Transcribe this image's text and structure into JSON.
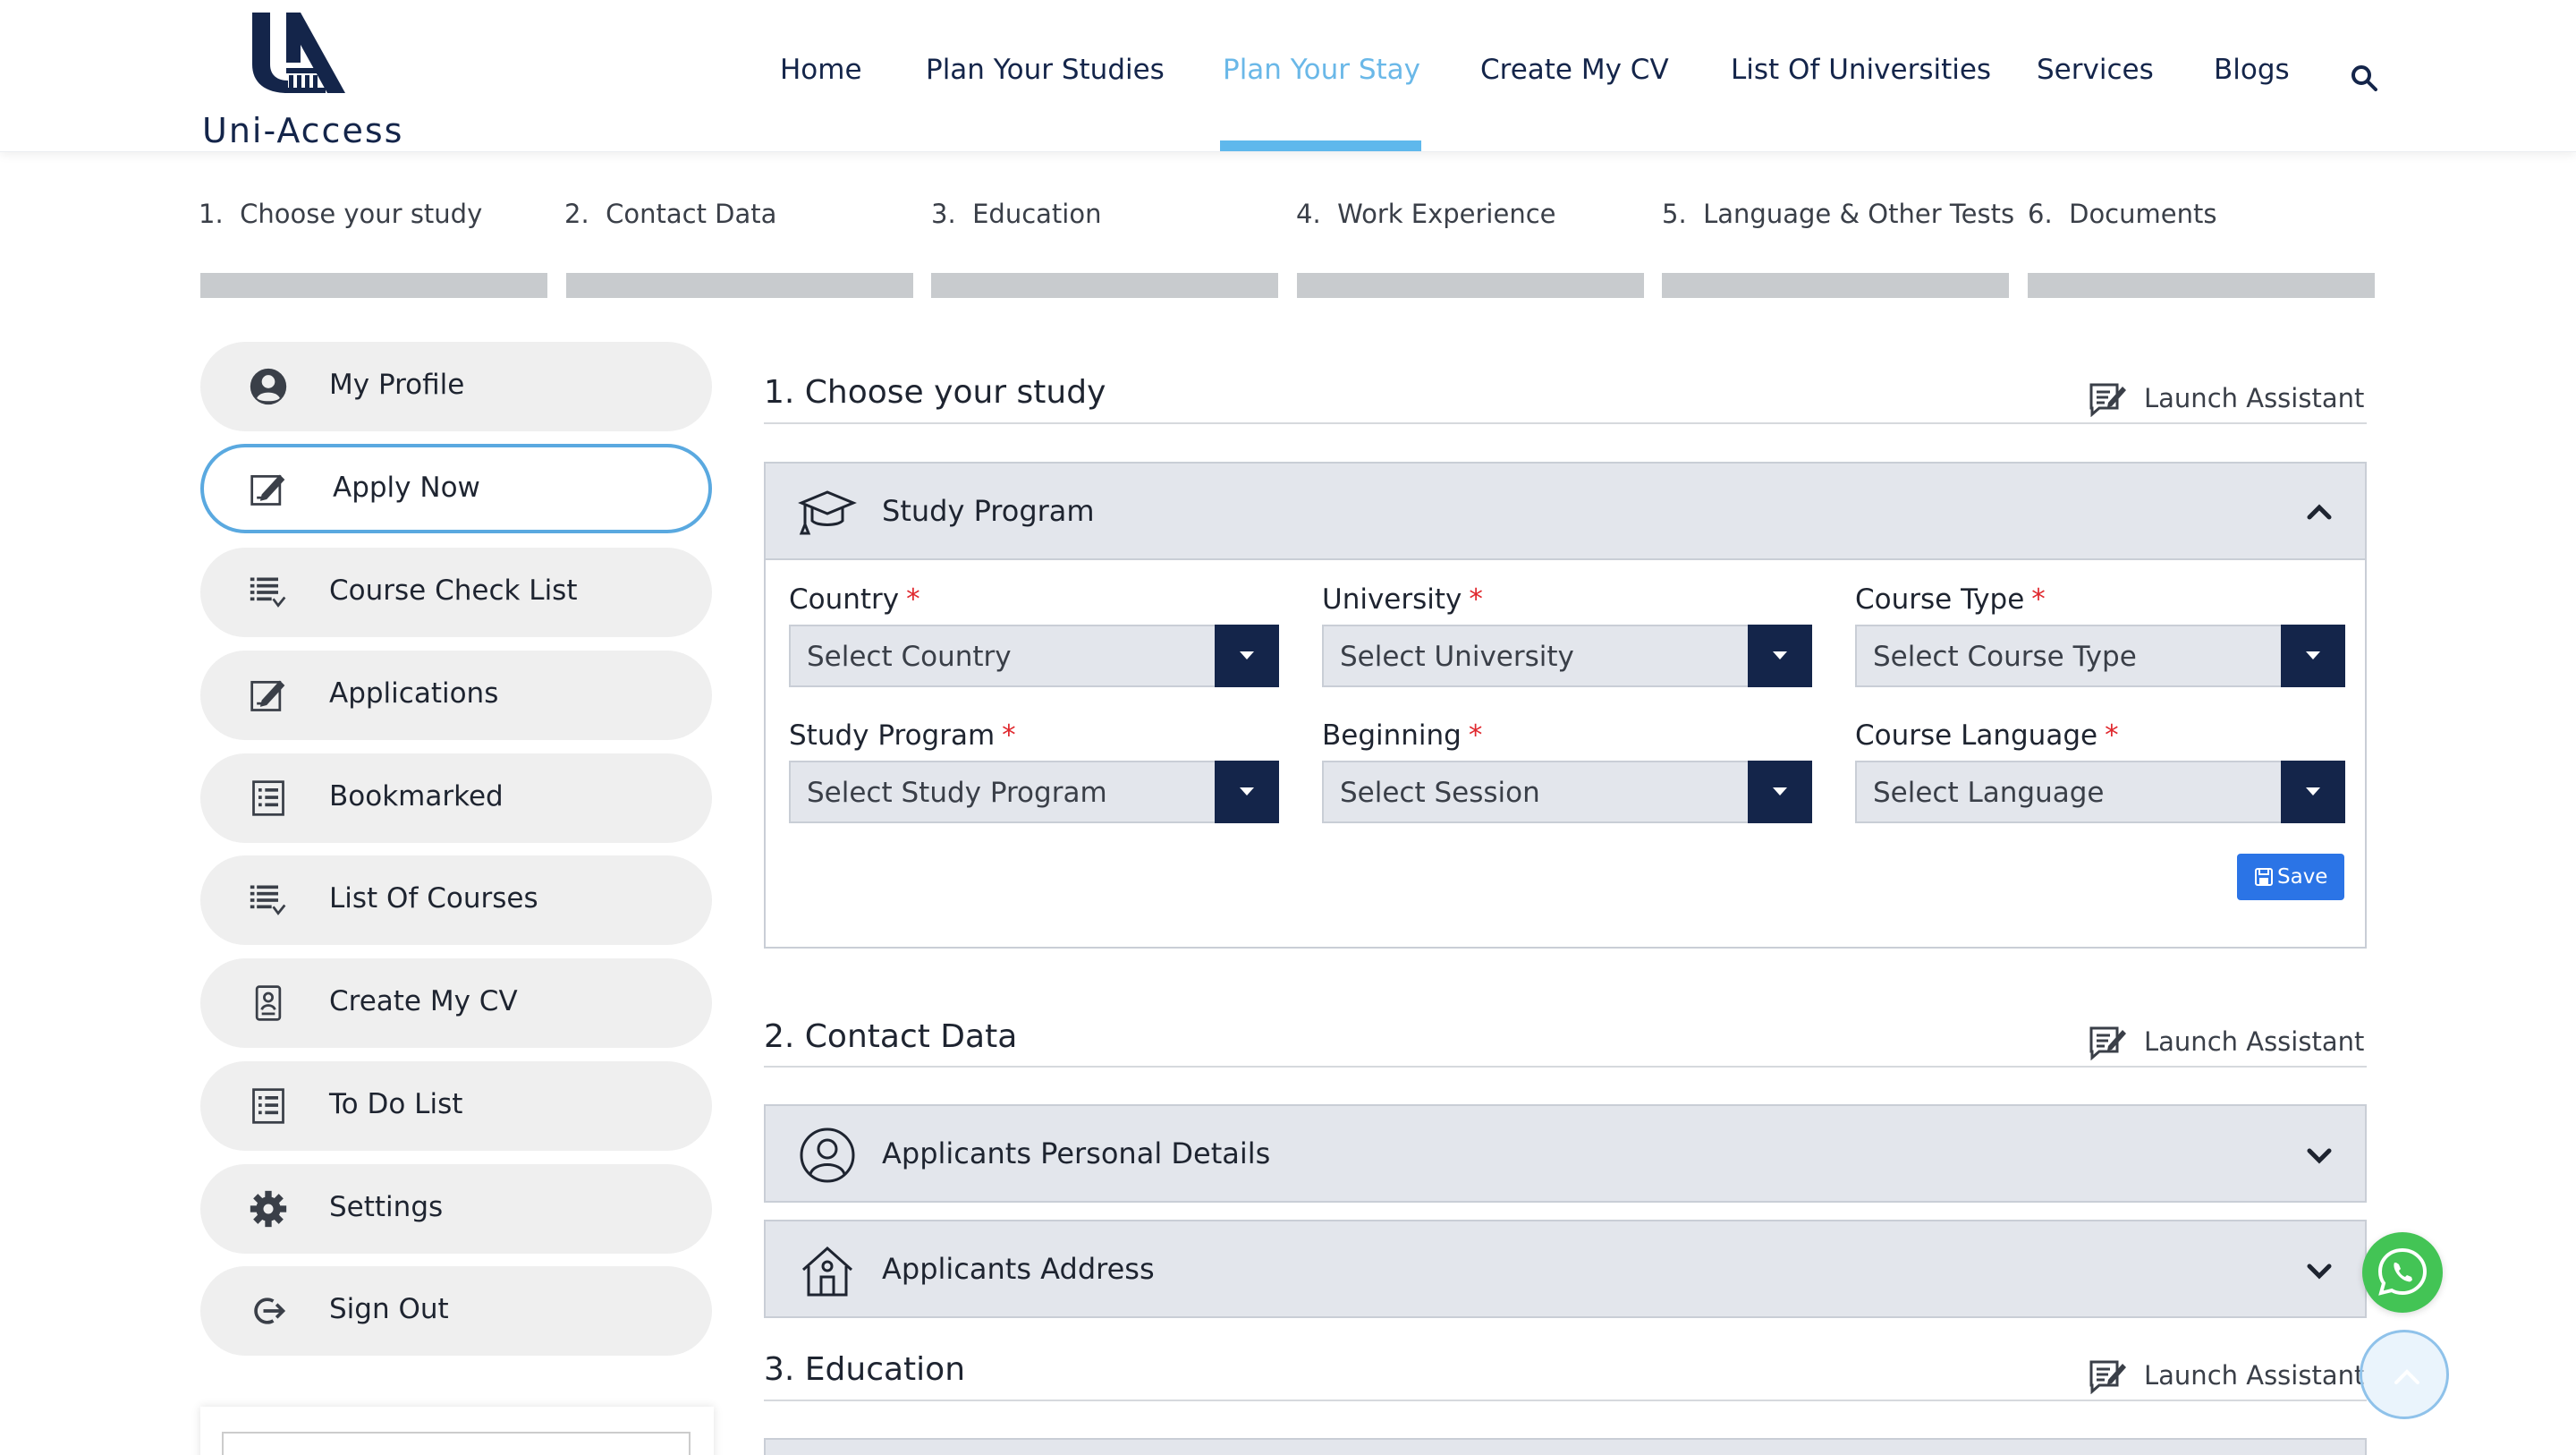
{
  "brand": {
    "name": "Uni-Access",
    "color": "#14254a"
  },
  "nav": {
    "items": [
      "Home",
      "Plan Your Studies",
      "Plan Your Stay",
      "Create My CV",
      "List Of Universities",
      "Services",
      "Blogs"
    ],
    "active": "Plan Your Stay",
    "active_color": "#6ab8e8",
    "search_icon": "search-icon"
  },
  "steps": [
    {
      "num": "1.",
      "label": "Choose your study"
    },
    {
      "num": "2.",
      "label": "Contact Data"
    },
    {
      "num": "3.",
      "label": "Education"
    },
    {
      "num": "4.",
      "label": "Work Experience"
    },
    {
      "num": "5.",
      "label": "Language & Other Tests"
    },
    {
      "num": "6.",
      "label": "Documents"
    }
  ],
  "sidebar": {
    "items": [
      {
        "label": "My Profile",
        "icon": "user-circle-icon"
      },
      {
        "label": "Apply Now",
        "icon": "edit-icon",
        "active": true
      },
      {
        "label": "Course Check List",
        "icon": "checklist-icon"
      },
      {
        "label": "Applications",
        "icon": "edit-icon"
      },
      {
        "label": "Bookmarked",
        "icon": "list-doc-icon"
      },
      {
        "label": "List Of Courses",
        "icon": "checklist-icon"
      },
      {
        "label": "Create My CV",
        "icon": "cv-icon"
      },
      {
        "label": "To Do List",
        "icon": "list-doc-icon"
      },
      {
        "label": "Settings",
        "icon": "gear-icon"
      },
      {
        "label": "Sign Out",
        "icon": "sign-out-icon"
      }
    ],
    "active_border_color": "#5aa9e0"
  },
  "launch_assistant_label": "Launch Assistant",
  "sections": {
    "study": {
      "title": "1. Choose your study",
      "accordion": {
        "title": "Study Program",
        "fields": [
          {
            "label": "Country",
            "placeholder": "Select Country"
          },
          {
            "label": "University",
            "placeholder": "Select University"
          },
          {
            "label": "Course Type",
            "placeholder": "Select Course Type"
          },
          {
            "label": "Study Program",
            "placeholder": "Select Study Program"
          },
          {
            "label": "Beginning",
            "placeholder": "Select Session"
          },
          {
            "label": "Course Language",
            "placeholder": "Select Language"
          }
        ],
        "required_mark": "*",
        "save_label": "Save"
      }
    },
    "contact": {
      "title": "2. Contact Data",
      "accordions": [
        "Applicants Personal Details",
        "Applicants Address"
      ]
    },
    "education": {
      "title": "3. Education"
    }
  },
  "colors": {
    "primary_dark": "#14254a",
    "save_blue": "#2b74e6",
    "whatsapp_green": "#43c455",
    "required_red": "#e0282e"
  }
}
